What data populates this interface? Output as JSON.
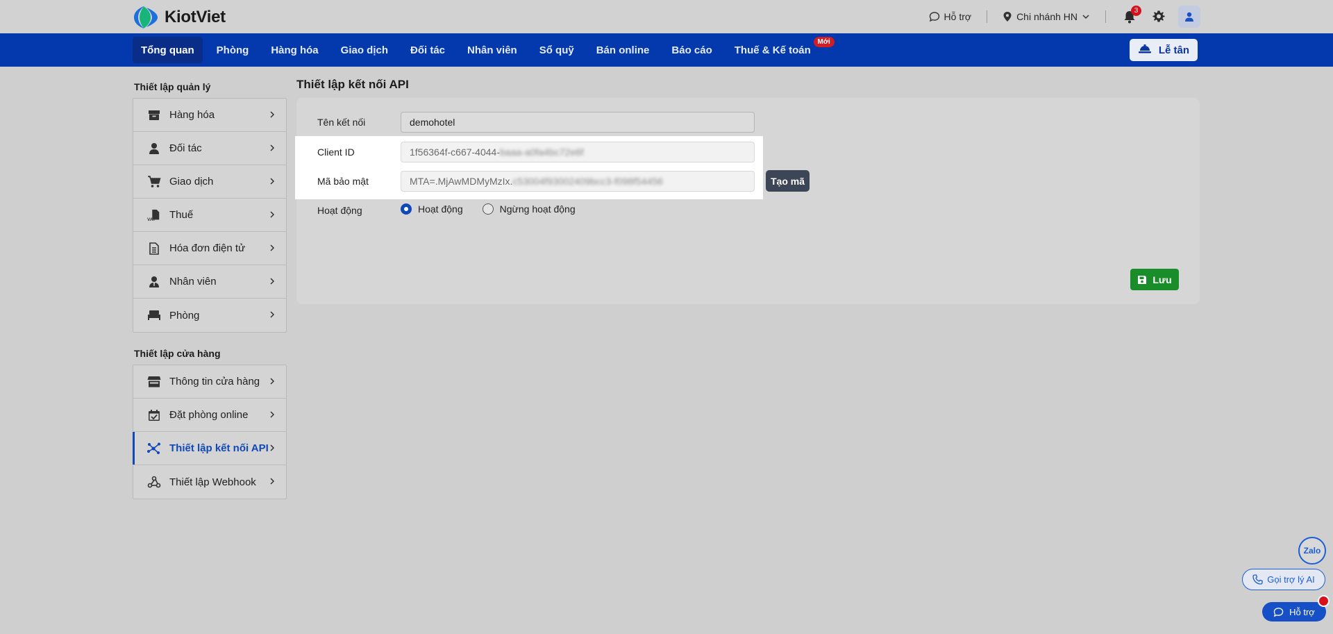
{
  "brand": {
    "name": "KiotViet"
  },
  "topbar": {
    "support_label": "Hỗ trợ",
    "branch_label": "Chi nhánh HN",
    "notification_count": "3"
  },
  "nav": {
    "items": [
      {
        "label": "Tổng quan"
      },
      {
        "label": "Phòng"
      },
      {
        "label": "Hàng hóa"
      },
      {
        "label": "Giao dịch"
      },
      {
        "label": "Đối tác"
      },
      {
        "label": "Nhân viên"
      },
      {
        "label": "Sổ quỹ"
      },
      {
        "label": "Bán online"
      },
      {
        "label": "Báo cáo"
      },
      {
        "label": "Thuế & Kế toán"
      }
    ],
    "new_badge": "Mới",
    "reception_label": "Lễ tân"
  },
  "sidebar": {
    "management_title": "Thiết lập quản lý",
    "management_items": [
      {
        "label": "Hàng hóa",
        "icon": "box-icon"
      },
      {
        "label": "Đối tác",
        "icon": "person-icon"
      },
      {
        "label": "Giao dịch",
        "icon": "cart-icon"
      },
      {
        "label": "Thuế",
        "icon": "vat-icon"
      },
      {
        "label": "Hóa đơn điện tử",
        "icon": "invoice-icon"
      },
      {
        "label": "Nhân viên",
        "icon": "employee-icon"
      },
      {
        "label": "Phòng",
        "icon": "bed-icon"
      }
    ],
    "store_title": "Thiết lập cửa hàng",
    "store_items": [
      {
        "label": "Thông tin cửa hàng",
        "icon": "store-icon"
      },
      {
        "label": "Đặt phòng online",
        "icon": "calendar-check-icon"
      },
      {
        "label": "Thiết lập kết nối API",
        "icon": "api-icon"
      },
      {
        "label": "Thiết lập Webhook",
        "icon": "webhook-icon"
      }
    ]
  },
  "main": {
    "title": "Thiết lập kết nối API",
    "connection_name_label": "Tên kết nối",
    "connection_name_value": "demohotel",
    "client_id_label": "Client ID",
    "client_id_value": "1f56364f-c667-4044-",
    "client_id_masked": "baaa-a0fa4bc72e6f",
    "secret_label": "Mã bảo mật",
    "secret_value": "MTA=.MjAwMDMyMzIx.",
    "secret_masked": "c53004f93002409bcc3-f098f54456",
    "generate_label": "Tạo mã",
    "status_label": "Hoạt động",
    "status_options": [
      {
        "label": "Hoạt động",
        "checked": true
      },
      {
        "label": "Ngừng hoạt động",
        "checked": false
      }
    ],
    "save_label": "Lưu"
  },
  "floating": {
    "zalo_label": "Zalo",
    "ai_label": "Gọi trợ lý AI",
    "support_label": "Hỗ trợ"
  },
  "colors": {
    "nav_bg": "#0339ad",
    "accent": "#1148b8",
    "save": "#1a8d2b",
    "badge": "#d8101b"
  }
}
